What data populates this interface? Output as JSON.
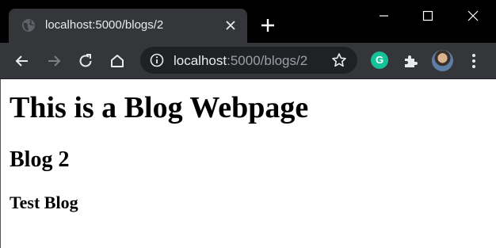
{
  "browser": {
    "tab": {
      "title": "localhost:5000/blogs/2",
      "favicon": "globe-icon"
    },
    "omnibox": {
      "host": "localhost",
      "path": ":5000/blogs/2"
    },
    "extensions": {
      "grammarly_letter": "G"
    },
    "colors": {
      "tabstrip": "#000000",
      "active_tab": "#35363a",
      "toolbar": "#35363a",
      "omnibox": "#202124",
      "grammarly": "#15c39a"
    }
  },
  "page": {
    "heading": "This is a Blog Webpage",
    "blog_title": "Blog 2",
    "blog_body": "Test Blog"
  }
}
